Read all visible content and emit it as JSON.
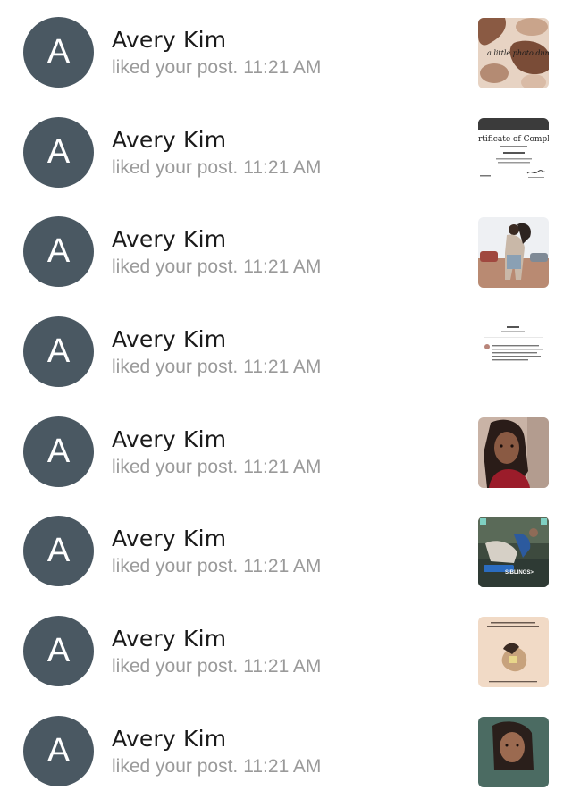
{
  "notifications": [
    {
      "avatar_letter": "A",
      "name": "Avery Kim",
      "action": "liked your post.",
      "time": "11:21 AM",
      "thumb_icon": "photo-dump-collage-thumbnail",
      "thumb_text": "a little photo dump"
    },
    {
      "avatar_letter": "A",
      "name": "Avery Kim",
      "action": "liked your post.",
      "time": "11:21 AM",
      "thumb_icon": "certificate-thumbnail",
      "thumb_text": "rtificate of Completi"
    },
    {
      "avatar_letter": "A",
      "name": "Avery Kim",
      "action": "liked your post.",
      "time": "11:21 AM",
      "thumb_icon": "people-photo-thumbnail",
      "thumb_text": ""
    },
    {
      "avatar_letter": "A",
      "name": "Avery Kim",
      "action": "liked your post.",
      "time": "11:21 AM",
      "thumb_icon": "text-screenshot-thumbnail",
      "thumb_text": ""
    },
    {
      "avatar_letter": "A",
      "name": "Avery Kim",
      "action": "liked your post.",
      "time": "11:21 AM",
      "thumb_icon": "selfie-photo-thumbnail",
      "thumb_text": ""
    },
    {
      "avatar_letter": "A",
      "name": "Avery Kim",
      "action": "liked your post.",
      "time": "11:21 AM",
      "thumb_icon": "siblings-photo-thumbnail",
      "thumb_text": "SIBLINGS>"
    },
    {
      "avatar_letter": "A",
      "name": "Avery Kim",
      "action": "liked your post.",
      "time": "11:21 AM",
      "thumb_icon": "quote-illustration-thumbnail",
      "thumb_text": ""
    },
    {
      "avatar_letter": "A",
      "name": "Avery Kim",
      "action": "liked your post.",
      "time": "11:21 AM",
      "thumb_icon": "portrait-photo-thumbnail",
      "thumb_text": ""
    }
  ],
  "colors": {
    "avatar_bg": "#4a5862",
    "name_text": "#1a1a1a",
    "secondary_text": "#9a9a9a",
    "background": "#ffffff"
  }
}
